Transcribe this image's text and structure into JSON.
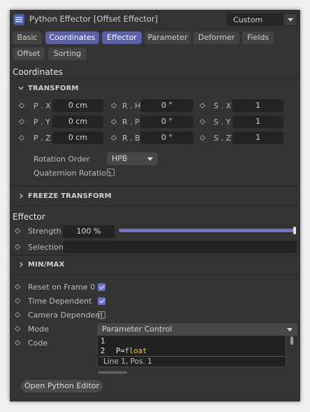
{
  "header": {
    "title": "Python Effector [Offset Effector]",
    "preset": "Custom"
  },
  "tabs": [
    {
      "label": "Basic",
      "active": false
    },
    {
      "label": "Coordinates",
      "active": true
    },
    {
      "label": "Effector",
      "active": true
    },
    {
      "label": "Parameter",
      "active": false
    },
    {
      "label": "Deformer",
      "active": false
    },
    {
      "label": "Fields",
      "active": false
    },
    {
      "label": "Offset",
      "active": false
    },
    {
      "label": "Sorting",
      "active": false
    }
  ],
  "coordinates": {
    "heading": "Coordinates",
    "transform_label": "TRANSFORM",
    "rows": [
      [
        {
          "label": "P . X",
          "value": "0 cm"
        },
        {
          "label": "R . H",
          "value": "0 °"
        },
        {
          "label": "S . X",
          "value": "1"
        }
      ],
      [
        {
          "label": "P . Y",
          "value": "0 cm"
        },
        {
          "label": "R . P",
          "value": "0 °"
        },
        {
          "label": "S . Y",
          "value": "1"
        }
      ],
      [
        {
          "label": "P . Z",
          "value": "0 cm"
        },
        {
          "label": "R . B",
          "value": "0 °"
        },
        {
          "label": "S . Z",
          "value": "1"
        }
      ]
    ],
    "rotation_order_label": "Rotation Order",
    "rotation_order_value": "HPB",
    "quaternion_label": "Quaternion Rotation",
    "quaternion_checked": false,
    "freeze_label": "FREEZE TRANSFORM"
  },
  "effector": {
    "heading": "Effector",
    "strength_label": "Strength",
    "strength_value": "100 %",
    "strength_fraction": 1.0,
    "selection_label": "Selection",
    "selection_value": "",
    "minmax_label": "MIN/MAX",
    "reset_label": "Reset on Frame 0",
    "reset_checked": true,
    "time_label": "Time Dependent",
    "time_checked": true,
    "camera_label": "Camera Dependent",
    "camera_checked": false,
    "mode_label": "Mode",
    "mode_value": "Parameter Control",
    "code_label": "Code",
    "code_lines": [
      {
        "num": "1",
        "text": ""
      },
      {
        "num": "2",
        "text_pre": "P=",
        "text_kw": "float"
      }
    ],
    "code_status": "Line 1, Pos. 1",
    "open_editor_label": "Open Python Editor"
  },
  "colors": {
    "accent": "#5b60a8",
    "panel": "#333333",
    "field": "#242424",
    "keyword": "#e8c35a"
  }
}
